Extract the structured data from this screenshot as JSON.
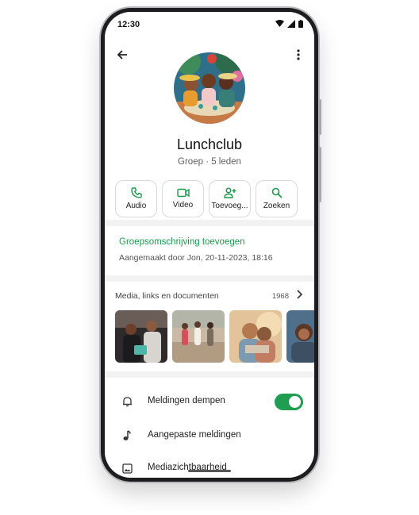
{
  "status_bar": {
    "time": "12:30"
  },
  "group": {
    "name": "Lunchclub",
    "meta": "Groep · 5 leden"
  },
  "actions": [
    {
      "label": "Audio",
      "icon": "phone-icon"
    },
    {
      "label": "Video",
      "icon": "video-icon"
    },
    {
      "label": "Toevoeg...",
      "icon": "add-person-icon"
    },
    {
      "label": "Zoeken",
      "icon": "search-icon"
    }
  ],
  "description": {
    "add_label": "Groepsomschrijving toevoegen",
    "created": "Aangemaakt door Jon, 20-11-2023, 18:16"
  },
  "media": {
    "title": "Media, links en documenten",
    "count": "1968"
  },
  "settings": [
    {
      "label": "Meldingen dempen",
      "icon": "bell-icon",
      "toggle_on": true
    },
    {
      "label": "Aangepaste meldingen",
      "icon": "music-note-icon"
    },
    {
      "label": "Mediazichtbaarheid",
      "icon": "image-icon"
    }
  ],
  "colors": {
    "accent": "#1d9a4c",
    "toggle": "#1f9e52"
  }
}
